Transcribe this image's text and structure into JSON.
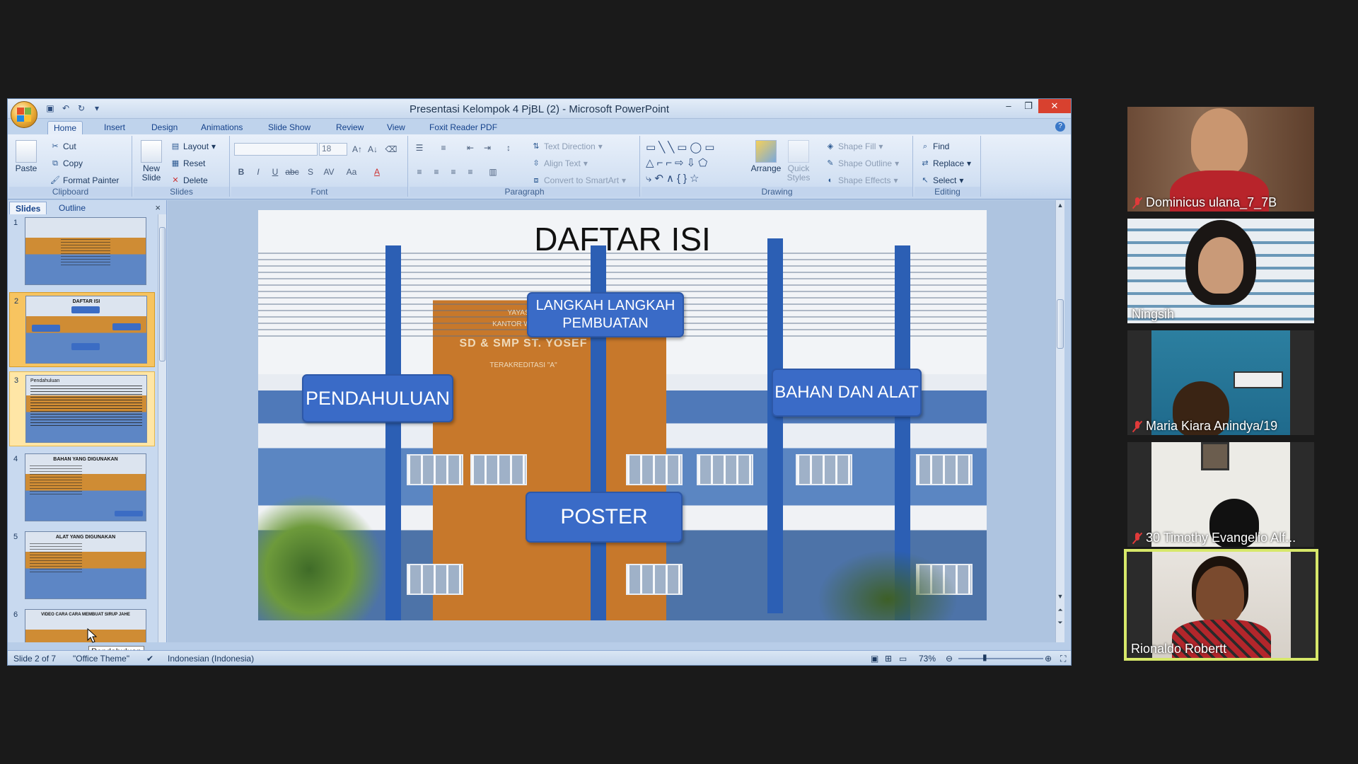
{
  "app": {
    "window_title": "Presentasi Kelompok 4 PjBL (2) - Microsoft PowerPoint",
    "tabs": [
      "Home",
      "Insert",
      "Design",
      "Animations",
      "Slide Show",
      "Review",
      "View",
      "Foxit Reader PDF"
    ],
    "active_tab": "Home"
  },
  "ribbon": {
    "clipboard": {
      "label": "Clipboard",
      "paste": "Paste",
      "cut": "Cut",
      "copy": "Copy",
      "format_painter": "Format Painter"
    },
    "slides": {
      "label": "Slides",
      "new_slide": "New Slide",
      "layout": "Layout",
      "reset": "Reset",
      "delete": "Delete"
    },
    "font": {
      "label": "Font",
      "size": "18"
    },
    "paragraph": {
      "label": "Paragraph",
      "text_direction": "Text Direction",
      "align_text": "Align Text",
      "convert_smartart": "Convert to SmartArt"
    },
    "drawing": {
      "label": "Drawing",
      "arrange": "Arrange",
      "quick_styles": "Quick Styles",
      "shape_fill": "Shape Fill",
      "shape_outline": "Shape Outline",
      "shape_effects": "Shape Effects"
    },
    "editing": {
      "label": "Editing",
      "find": "Find",
      "replace": "Replace",
      "select": "Select"
    }
  },
  "pane": {
    "tab_slides": "Slides",
    "tab_outline": "Outline",
    "close": "×",
    "thumbnails": [
      {
        "num": "1",
        "title": ""
      },
      {
        "num": "2",
        "title": "DAFTAR ISI"
      },
      {
        "num": "3",
        "title": "Pendahuluan"
      },
      {
        "num": "4",
        "title": "BAHAN YANG DIGUNAKAN"
      },
      {
        "num": "5",
        "title": "ALAT YANG DIGUNAKAN"
      },
      {
        "num": "6",
        "title": "VIDEO CARA CARA MEMBUAT SIRUP JAHE"
      }
    ],
    "tooltip": "Pendahuluan"
  },
  "slide": {
    "title": "DAFTAR ISI",
    "boxes": {
      "langkah": "LANGKAH LANGKAH PEMBUATAN",
      "pendahuluan": "PENDAHULUAN",
      "bahan": "BAHAN DAN ALAT",
      "poster": "POSTER"
    },
    "sign_line1": "SD & SMP ST. YOSEF",
    "sign_line2": "TERAKREDITASI \"A\"",
    "sign_yayasan": "YAYASAN",
    "sign_kantor": "KANTOR WILAYAH"
  },
  "status": {
    "slide_of": "Slide 2 of 7",
    "theme": "\"Office Theme\"",
    "language": "Indonesian (Indonesia)",
    "zoom": "73%"
  },
  "participants": [
    {
      "name": "Dominicus ulana_7_7B",
      "muted": true
    },
    {
      "name": "Ningsih",
      "muted": false
    },
    {
      "name": "Maria Kiara Anindya/19",
      "muted": true
    },
    {
      "name": "30 Timothy Evangelio Alf...",
      "muted": true
    },
    {
      "name": "Rionaldo Robertt",
      "muted": false,
      "active_speaker": true
    }
  ],
  "colors": {
    "slide_box": "#3a6bc7",
    "active_speaker_border": "#d7e86a",
    "close_button": "#d8412f"
  }
}
